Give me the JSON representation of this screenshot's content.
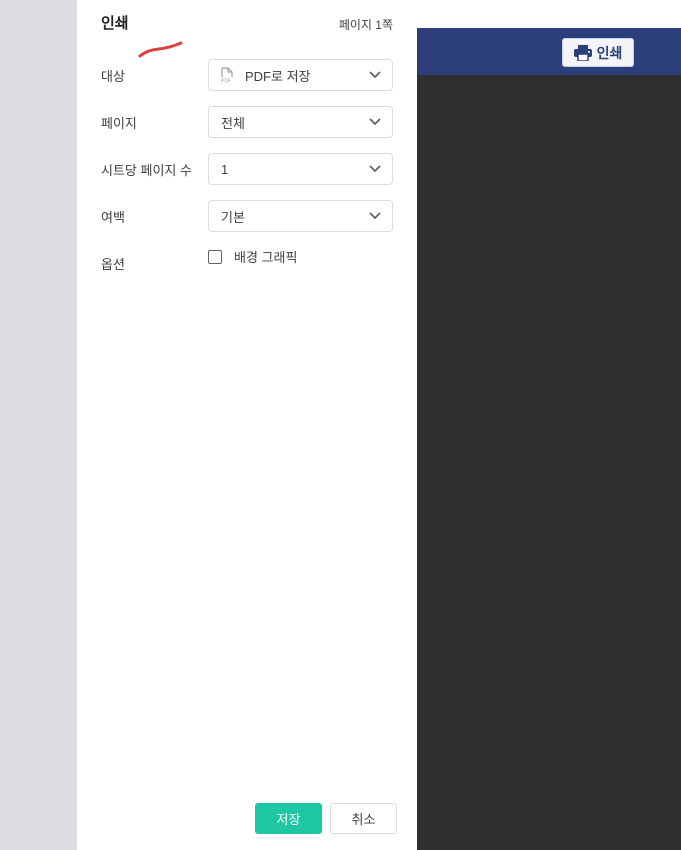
{
  "background": {
    "print_button_label": "인쇄",
    "print_icon": "printer-icon"
  },
  "dialog": {
    "title": "인쇄",
    "page_count": "페이지 1쪽",
    "fields": {
      "destination": {
        "label": "대상",
        "value": "PDF로 저장",
        "icon": "pdf-file-icon"
      },
      "pages": {
        "label": "페이지",
        "value": "전체"
      },
      "pages_per_sheet": {
        "label": "시트당 페이지 수",
        "value": "1"
      },
      "margins": {
        "label": "여백",
        "value": "기본"
      },
      "options": {
        "label": "옵션",
        "checkbox_label": "배경 그래픽",
        "checked": false
      }
    },
    "save_label": "저장",
    "cancel_label": "취소",
    "accent_color": "#1ec7a4"
  }
}
